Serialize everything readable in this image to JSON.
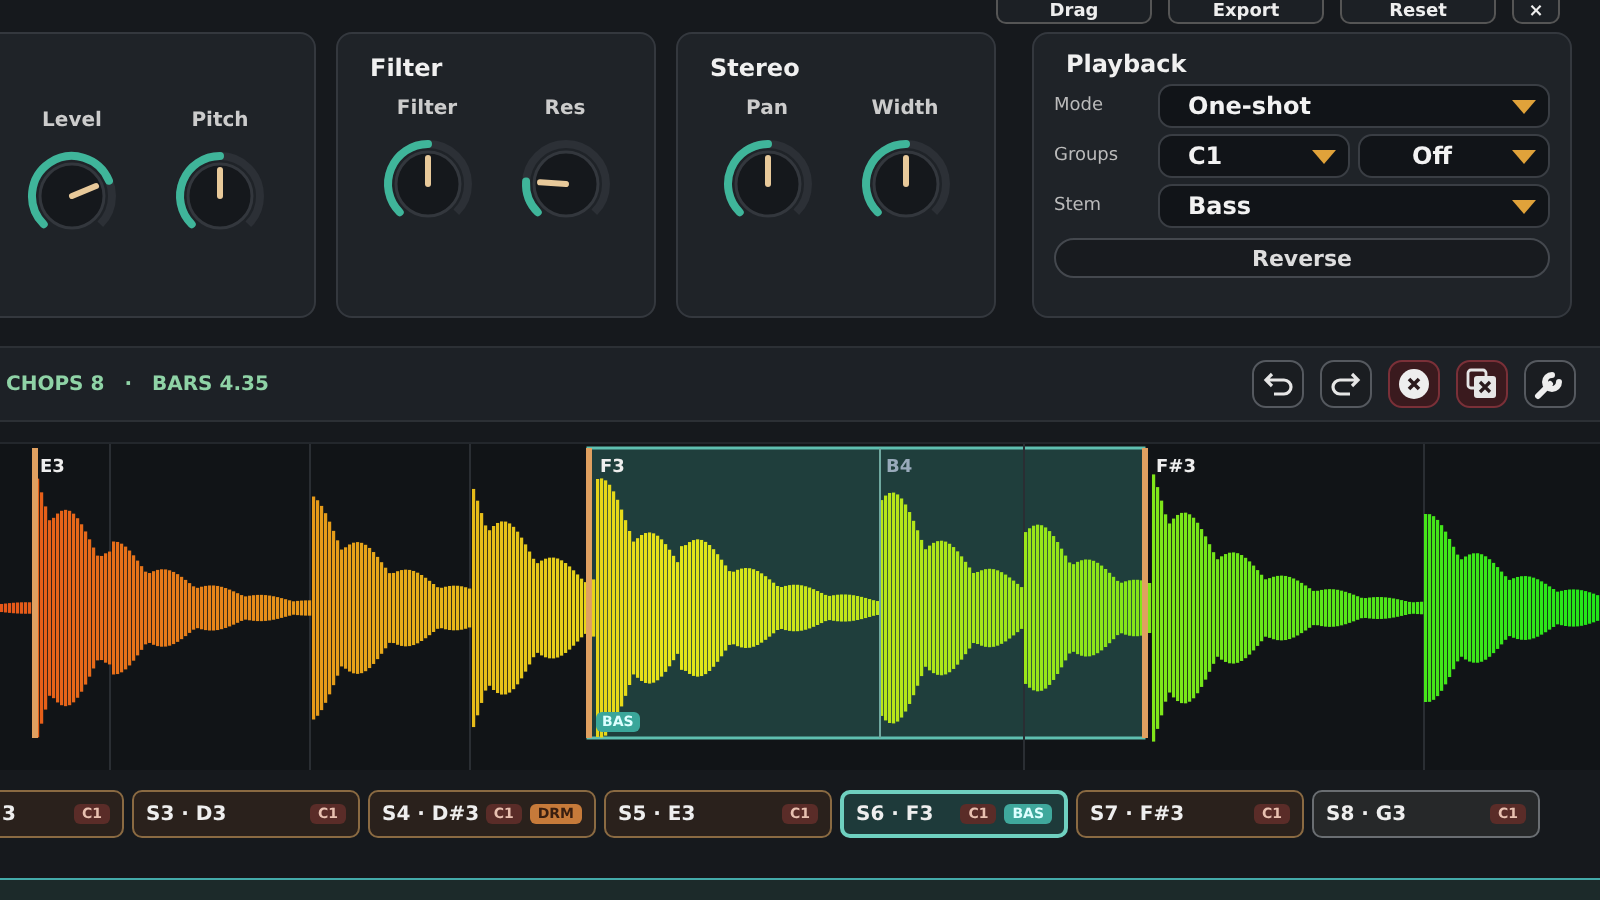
{
  "top_buttons": [
    "Drag",
    "Export",
    "Reset",
    "×"
  ],
  "panels": [
    {
      "knobs": [
        {
          "label": "Level",
          "level": 0.75
        },
        {
          "label": "Pitch",
          "level": 0.5
        }
      ]
    },
    {
      "title": "Filter",
      "knobs": [
        {
          "label": "Filter",
          "level": 0.5
        },
        {
          "label": "Res",
          "level": 0.18
        }
      ]
    },
    {
      "title": "Stereo",
      "knobs": [
        {
          "label": "Pan",
          "level": 0.5
        },
        {
          "label": "Width",
          "level": 0.5
        }
      ]
    }
  ],
  "playback": {
    "title": "Playback",
    "mode_label": "Mode",
    "mode": "One-shot",
    "groups_label": "Groups",
    "group": "C1",
    "group_2": "Off",
    "stem_label": "Stem",
    "stem": "Bass",
    "reverse": "Reverse"
  },
  "toolbar": {
    "chops": "CHOPS 8",
    "separator": "·",
    "bars": "BARS 4.35",
    "buttons": [
      {
        "danger": false
      },
      {
        "danger": false
      },
      {
        "danger": true
      },
      {
        "danger": true
      },
      {
        "danger": false
      }
    ]
  },
  "waveform": {
    "markers": [
      "E3",
      "F3",
      "B4",
      "F#3"
    ],
    "region_tag": "BAS"
  },
  "chops": [
    {
      "label": "3",
      "tags": [
        {
          "text": "C1",
          "kind": "group"
        }
      ],
      "selected": false
    },
    {
      "label": "S3 · D3",
      "tags": [
        {
          "text": "C1",
          "kind": "group"
        }
      ],
      "selected": false
    },
    {
      "label": "S4 · D#3",
      "tags": [
        {
          "text": "C1",
          "kind": "group"
        },
        {
          "text": "DRM",
          "kind": "stem"
        }
      ],
      "selected": false
    },
    {
      "label": "S5 · E3",
      "tags": [
        {
          "text": "C1",
          "kind": "group"
        }
      ],
      "selected": false
    },
    {
      "label": "S6 · F3",
      "tags": [
        {
          "text": "C1",
          "kind": "group"
        },
        {
          "text": "BAS",
          "kind": "stem"
        }
      ],
      "selected": true
    },
    {
      "label": "S7 · F#3",
      "tags": [
        {
          "text": "C1",
          "kind": "group"
        }
      ],
      "selected": false
    },
    {
      "label": "S8 · G3",
      "tags": [
        {
          "text": "C1",
          "kind": "group"
        }
      ],
      "selected": false
    }
  ]
}
